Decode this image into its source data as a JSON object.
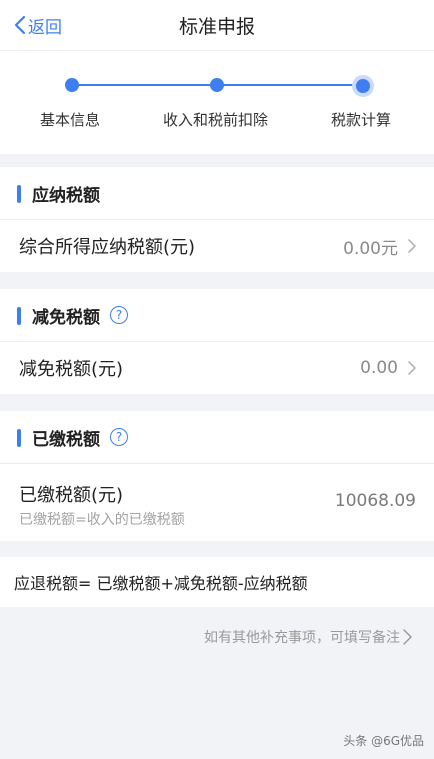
{
  "header": {
    "back_label": "返回",
    "title": "标准申报"
  },
  "steps": [
    {
      "label": "基本信息",
      "state": "done"
    },
    {
      "label": "收入和税前扣除",
      "state": "done"
    },
    {
      "label": "税款计算",
      "state": "active"
    }
  ],
  "sections": {
    "payable": {
      "title": "应纳税额",
      "row_label": "综合所得应纳税额(元)",
      "row_value": "0.00元"
    },
    "reduction": {
      "title": "减免税额",
      "help_icon_glyph": "?",
      "row_label": "减免税额(元)",
      "row_value": "0.00"
    },
    "paid": {
      "title": "已缴税额",
      "help_icon_glyph": "?",
      "row_label": "已缴税额(元)",
      "row_sub": "已缴税额=收入的已缴税额",
      "row_value": "10068.09"
    }
  },
  "formula": "应退税额= 已缴税额+减免税额-应纳税额",
  "note": "如有其他补充事项，可填写备注",
  "watermark": "头条 @6G优品",
  "colors": {
    "accent": "#3d7ff0",
    "background": "#f2f3f7"
  }
}
